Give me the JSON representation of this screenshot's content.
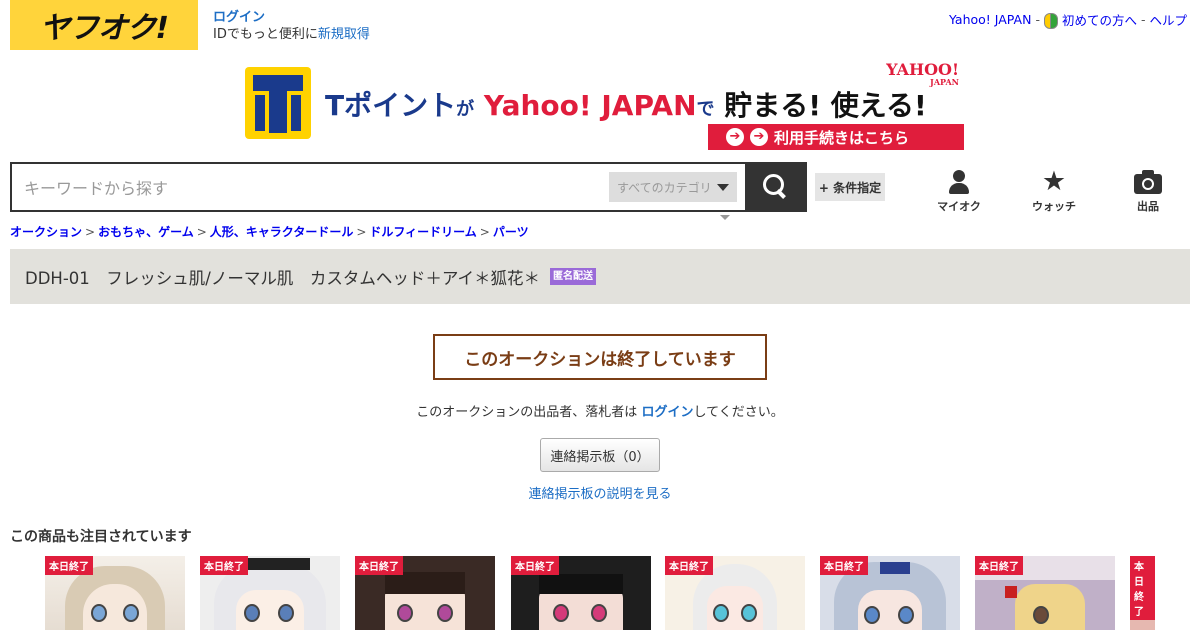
{
  "header": {
    "logo_text": "ヤフオク!",
    "login_label": "ログイン",
    "login_sub_prefix": "IDでもっと便利に",
    "register_label": "新規取得",
    "top_links": {
      "yahoo": "Yahoo! JAPAN",
      "sep": "-",
      "beginner": "初めての方へ",
      "help": "ヘルプ"
    }
  },
  "banner": {
    "tpoint": "Tポイント",
    "ga": "が",
    "yahoo_japan": "Yahoo! JAPAN",
    "de": "で",
    "save_use": "貯まる! 使える!",
    "yahoo_logo": "YAHOO!",
    "yahoo_logo_sub": "JAPAN",
    "cta": "利用手続きはこちら"
  },
  "search": {
    "placeholder": "キーワードから探す",
    "category": "すべてのカテゴリ",
    "condition_label": "+ 条件指定"
  },
  "nav": {
    "myauction": "マイオク",
    "watch": "ウォッチ",
    "sell": "出品"
  },
  "breadcrumb": [
    "オークション",
    "おもちゃ、ゲーム",
    "人形、キャラクタードール",
    "ドルフィードリーム",
    "パーツ"
  ],
  "breadcrumb_sep": ">",
  "item": {
    "title": "DDH-01　フレッシュ肌/ノーマル肌　カスタムヘッド＋アイ＊狐花＊",
    "anon_badge": "匿名配送"
  },
  "ended": {
    "notice": "このオークションは終了しています",
    "msg_prefix": "このオークションの出品者、落札者は",
    "msg_login": "ログイン",
    "msg_suffix": "してください。",
    "board_button": "連絡掲示板（0）",
    "board_help": "連絡掲示板の説明を見る"
  },
  "related": {
    "title": "この商品も注目されています",
    "badge": "本日終了",
    "items": [
      "本日終了",
      "本日終了",
      "本日終了",
      "本日終了",
      "本日終了",
      "本日終了",
      "本日終了",
      "本日終了"
    ]
  },
  "colors": {
    "accent_blue": "#1d6ec5",
    "logo_yellow": "#ffd43b",
    "ended_brown": "#7a3d15",
    "badge_red": "#e01d3c",
    "anon_purple": "#9a6ad8"
  }
}
